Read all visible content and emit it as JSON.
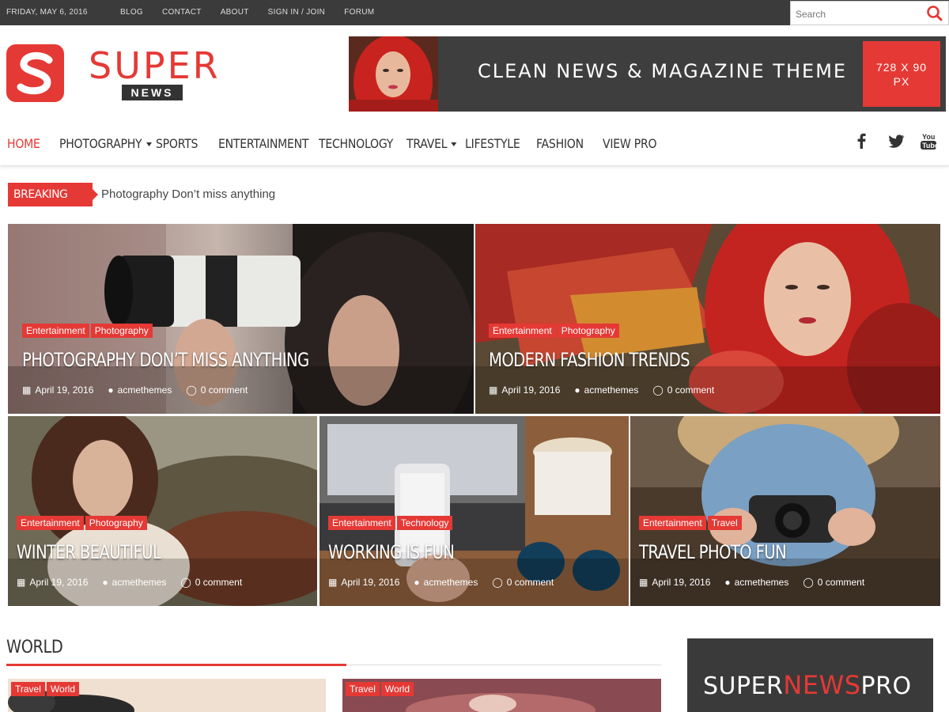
{
  "topbar": {
    "date": "FRIDAY, MAY 6, 2016",
    "links": [
      "BLOG",
      "CONTACT",
      "ABOUT",
      "SIGN IN / JOIN",
      "FORUM"
    ],
    "search_placeholder": "Search"
  },
  "logo": {
    "word": "SUPER",
    "sub": "NEWS"
  },
  "ad": {
    "text": "CLEAN NEWS & MAGAZINE THEME",
    "size_line1": "728 X 90",
    "size_line2": "PX"
  },
  "nav": {
    "items": [
      "HOME",
      "PHOTOGRAPHY",
      "SPORTS",
      "ENTERTAINMENT",
      "TECHNOLOGY",
      "TRAVEL",
      "LIFESTYLE",
      "FASHION",
      "VIEW PRO"
    ],
    "social_icons": [
      "facebook-icon",
      "twitter-icon",
      "youtube-icon"
    ]
  },
  "breaking": {
    "label": "BREAKING NEWS",
    "headline": "Photography Don’t miss anything"
  },
  "tiles": [
    {
      "cats": [
        "Entertainment",
        "Photography"
      ],
      "title": "PHOTOGRAPHY DON’T MISS ANYTHING",
      "date": "April 19, 2016",
      "author": "acmethemes",
      "comments": "0 comment"
    },
    {
      "cats": [
        "Entertainment",
        "Photography"
      ],
      "title": "MODERN FASHION TRENDS",
      "date": "April 19, 2016",
      "author": "acmethemes",
      "comments": "0 comment"
    },
    {
      "cats": [
        "Entertainment",
        "Photography"
      ],
      "title": "WINTER BEAUTIFUL",
      "date": "April 19, 2016",
      "author": "acmethemes",
      "comments": "0 comment"
    },
    {
      "cats": [
        "Entertainment",
        "Technology"
      ],
      "title": "WORKING IS FUN",
      "date": "April 19, 2016",
      "author": "acmethemes",
      "comments": "0 comment"
    },
    {
      "cats": [
        "Entertainment",
        "Travel"
      ],
      "title": "TRAVEL PHOTO FUN",
      "date": "April 19, 2016",
      "author": "acmethemes",
      "comments": "0 comment"
    }
  ],
  "world": {
    "title": "WORLD",
    "cards": [
      {
        "cats": [
          "Travel",
          "World"
        ]
      },
      {
        "cats": [
          "Travel",
          "World"
        ]
      }
    ]
  },
  "pro": {
    "part1": "SUPER",
    "part2": "NEWS",
    "part3": "PRO"
  },
  "colors": {
    "accent": "#e53935",
    "topbar": "#3b3b3b",
    "ad_bg": "#3e3e3e"
  }
}
